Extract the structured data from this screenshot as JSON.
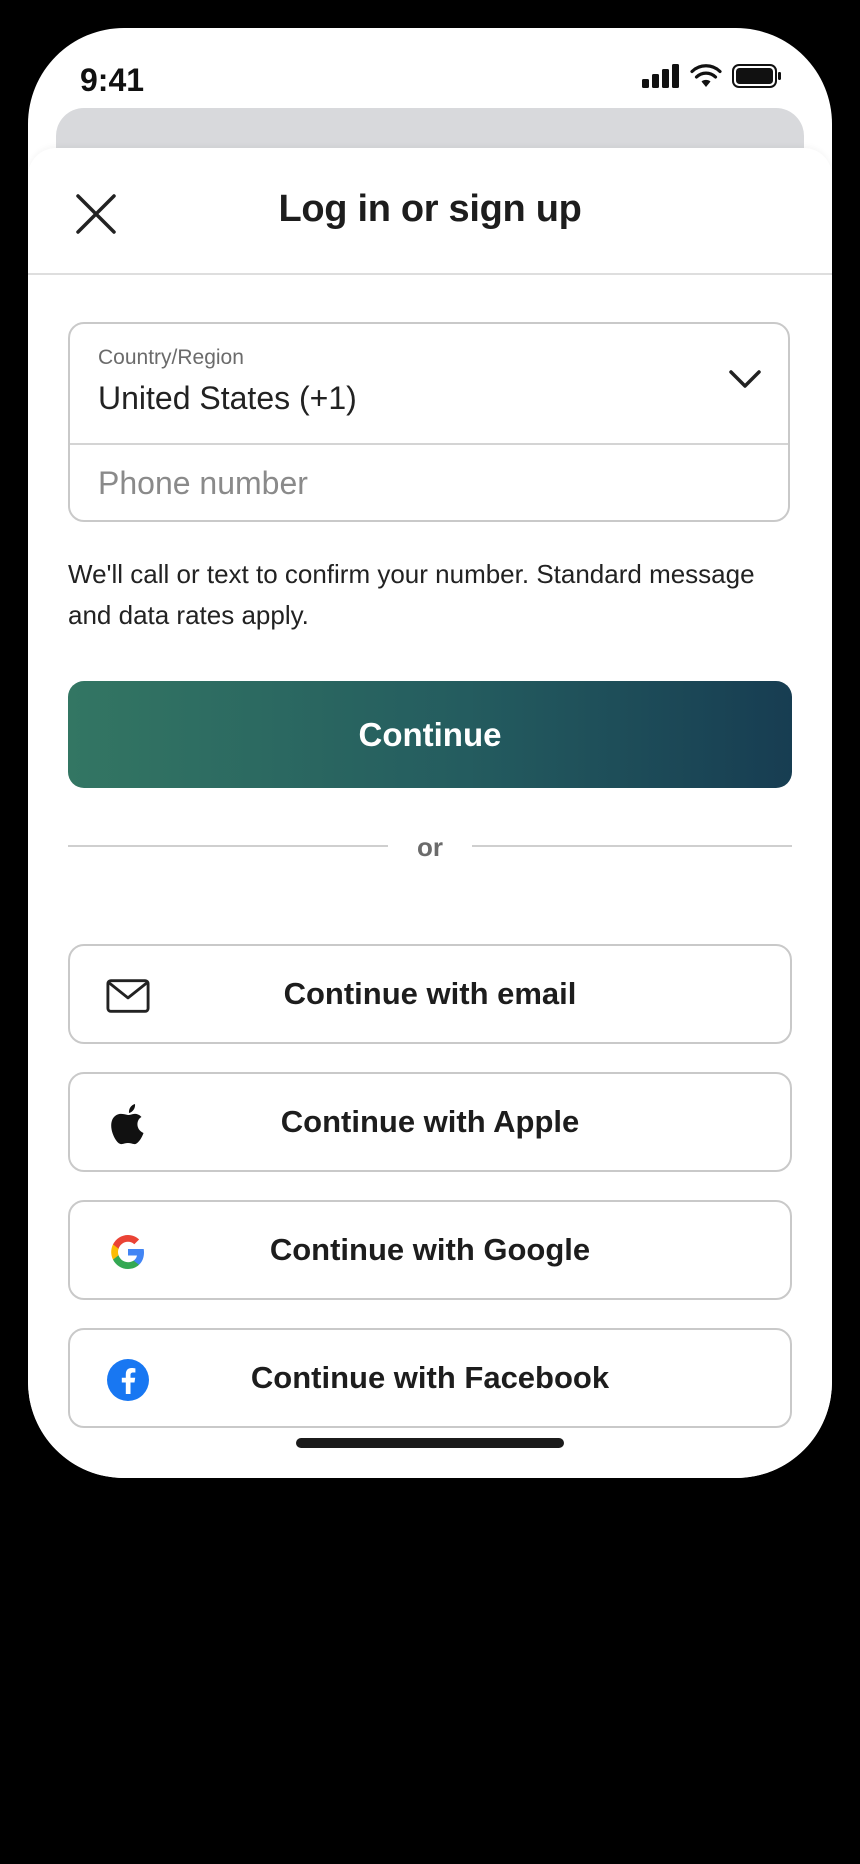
{
  "status_bar": {
    "time": "9:41"
  },
  "header": {
    "title": "Log in or sign up",
    "close_icon": "close-icon"
  },
  "country": {
    "label": "Country/Region",
    "value": "United States (+1)"
  },
  "phone": {
    "placeholder": "Phone number",
    "value": ""
  },
  "disclaimer": "We'll call or text to confirm your number. Standard message and data rates apply.",
  "continue_label": "Continue",
  "divider_text": "or",
  "social": {
    "email": {
      "label": "Continue with email",
      "icon": "mail-icon"
    },
    "apple": {
      "label": "Continue with Apple",
      "icon": "apple-icon"
    },
    "google": {
      "label": "Continue with Google",
      "icon": "google-icon"
    },
    "facebook": {
      "label": "Continue with Facebook",
      "icon": "facebook-icon"
    }
  },
  "colors": {
    "continue_gradient_start": "#337663",
    "continue_gradient_end": "#173d52",
    "facebook_blue": "#1877f2"
  }
}
